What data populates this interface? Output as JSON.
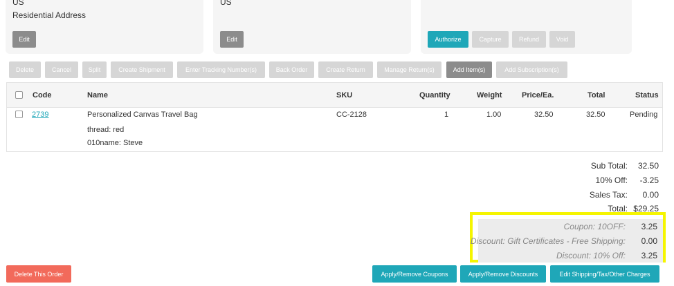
{
  "addresses": {
    "left": {
      "country": "US",
      "type": "Residential Address",
      "edit_label": "Edit"
    },
    "middle": {
      "country": "US",
      "edit_label": "Edit"
    }
  },
  "payment": {
    "authorize_label": "Authorize",
    "capture_label": "Capture",
    "refund_label": "Refund",
    "void_label": "Void"
  },
  "toolbar": {
    "delete_label": "Delete",
    "cancel_label": "Cancel",
    "split_label": "Split",
    "create_shipment_label": "Create Shipment",
    "enter_tracking_label": "Enter Tracking Number(s)",
    "back_order_label": "Back Order",
    "create_return_label": "Create Return",
    "manage_returns_label": "Manage Return(s)",
    "add_items_label": "Add Item(s)",
    "add_subscriptions_label": "Add Subscription(s)"
  },
  "table": {
    "headers": {
      "code": "Code",
      "name": "Name",
      "sku": "SKU",
      "quantity": "Quantity",
      "weight": "Weight",
      "price": "Price/Ea.",
      "total": "Total",
      "status": "Status"
    },
    "rows": [
      {
        "code": "2739",
        "name": "Personalized Canvas Travel Bag",
        "option1": "thread: red",
        "option2": "010name: Steve",
        "sku": "CC-2128",
        "quantity": "1",
        "weight": "1.00",
        "price": "32.50",
        "total": "32.50",
        "status": "Pending"
      }
    ]
  },
  "totals": {
    "subtotal_label": "Sub Total:",
    "subtotal_value": "32.50",
    "discount_label": "10% Off:",
    "discount_value": "-3.25",
    "tax_label": "Sales Tax:",
    "tax_value": "0.00",
    "total_label": "Total:",
    "total_value": "$29.25"
  },
  "discounts": [
    {
      "label": "Coupon: 10OFF:",
      "value": "3.25"
    },
    {
      "label": "Discount: Gift Certificates - Free Shipping:",
      "value": "0.00"
    },
    {
      "label": "Discount: 10% Off:",
      "value": "3.25"
    }
  ],
  "footer": {
    "delete_order_label": "Delete This Order",
    "apply_coupons_label": "Apply/Remove Coupons",
    "apply_discounts_label": "Apply/Remove Discounts",
    "edit_shipping_label": "Edit Shipping/Tax/Other Charges"
  },
  "colors": {
    "teal": "#1fa7b8",
    "gray_button": "#8c8c8c",
    "disabled_button": "#d6d6d6",
    "danger": "#f26a5b",
    "highlight": "#f5f500"
  }
}
